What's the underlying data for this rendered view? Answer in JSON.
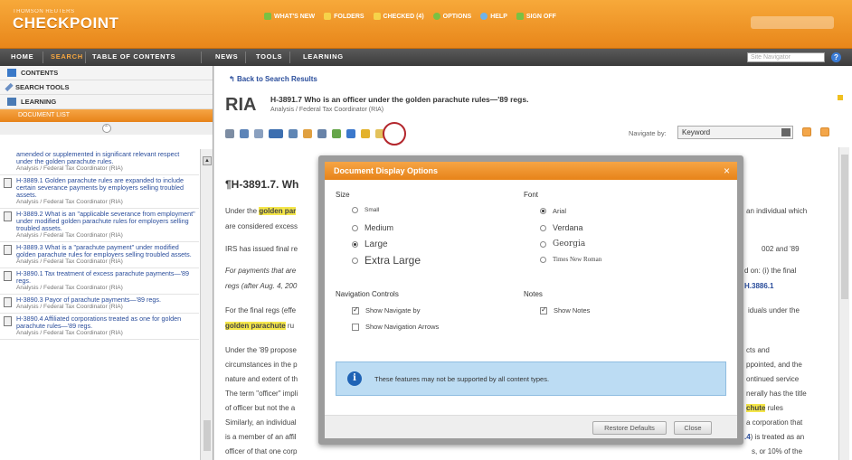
{
  "header": {
    "brand_small": "THOMSON REUTERS",
    "brand": "CHECKPOINT",
    "top_links": [
      "WHAT'S NEW",
      "FOLDERS",
      "CHECKED (4)",
      "OPTIONS",
      "HELP",
      "SIGN OFF"
    ],
    "top_link_colors": [
      "#7ac143",
      "#f6d34a",
      "#f6d34a",
      "#7ac143",
      "#6fb3e8",
      "#7ac143"
    ]
  },
  "nav": {
    "items": [
      "HOME",
      "SEARCH",
      "TABLE OF CONTENTS",
      "NEWS",
      "TOOLS",
      "LEARNING"
    ],
    "active": "SEARCH",
    "site_navigator_placeholder": "Site Navigator",
    "help": "?"
  },
  "sidebar": {
    "sections": [
      "CONTENTS",
      "SEARCH TOOLS",
      "LEARNING"
    ],
    "document_panel": "DOCUMENT LIST",
    "documents": [
      {
        "title": "amended or supplemented in significant relevant respect under the golden parachute rules.",
        "source": "Analysis / Federal Tax Coordinator (RIA)",
        "icon": false
      },
      {
        "title": "H-3889.1 Golden parachute rules are expanded to include certain severance payments by employers selling troubled assets.",
        "source": "Analysis / Federal Tax Coordinator (RIA)",
        "icon": true
      },
      {
        "title": "H-3889.2 What is an \"applicable severance from employment\" under modified golden parachute rules for employers selling troubled assets.",
        "source": "Analysis / Federal Tax Coordinator (RIA)",
        "icon": true
      },
      {
        "title": "H-3889.3 What is a \"parachute payment\" under modified golden parachute rules for employers selling troubled assets.",
        "source": "Analysis / Federal Tax Coordinator (RIA)",
        "icon": true
      },
      {
        "title": "H-3890.1 Tax treatment of excess parachute payments—'89 regs.",
        "source": "Analysis / Federal Tax Coordinator (RIA)",
        "icon": true
      },
      {
        "title": "H-3890.3 Payor of parachute payments—'89 regs.",
        "source": "Analysis / Federal Tax Coordinator (RIA)",
        "icon": true
      },
      {
        "title": "H-3890.4 Affiliated corporations treated as one for golden parachute rules—'89 regs.",
        "source": "Analysis / Federal Tax Coordinator (RIA)",
        "icon": true
      }
    ]
  },
  "main": {
    "back_link": "Back to Search Results",
    "ria": "RIA",
    "doc_title": "H-3891.7 Who is an officer under the golden parachute rules—'89 regs.",
    "doc_subtitle": "Analysis / Federal Tax Coordinator (RIA)",
    "navigate_by_label": "Navigate by:",
    "navigate_by_value": "Keyword",
    "para_heading": "¶H-3891.7. Wh",
    "body": {
      "l1_pre": "Under the ",
      "l1_hl": "golden par",
      "l2": "are considered excess",
      "l3": "IRS has issued final re",
      "l4": "For payments that are",
      "l5": "regs (after Aug. 4, 200",
      "l6": "For the final regs (effe",
      "l7_hl": "golden parachute",
      "l7_post": " ru",
      "l8": "Under the '89 propose",
      "l9": "circumstances in the p",
      "l10": "nature and extent of th",
      "l11": "The term \"officer\" impli",
      "l12": "of officer but not the a",
      "l13": "Similarly, an individual",
      "l14": "is a member of an affil",
      "l15": "officer of that one corp"
    },
    "body_right": {
      "r1": "an individual which",
      "r2": "002 and '89",
      "r3": "d on: (i) the final",
      "r4": "H.3886.1",
      "r5": "iduals under the",
      "r6": "cts and",
      "r7": "ppointed, and the",
      "r8": "ontinued service",
      "r9": "nerally has the title",
      "r10_hl": "chute",
      "r10_post": " rules",
      "r11": "a corporation that",
      "r12_link": ".4",
      "r12_post": ") is treated as an",
      "r13": "s, or 10% of the"
    }
  },
  "dialog": {
    "title": "Document Display Options",
    "close": "×",
    "size_label": "Size",
    "sizes": [
      "Small",
      "Medium",
      "Large",
      "Extra Large"
    ],
    "size_selected": "Large",
    "font_label": "Font",
    "fonts": [
      "Arial",
      "Verdana",
      "Georgia",
      "Times New Roman"
    ],
    "font_selected": "Arial",
    "navigation_label": "Navigation Controls",
    "show_navigate_by": "Show Navigate by",
    "show_navigate_by_checked": true,
    "show_navigation_arrows": "Show Navigation Arrows",
    "show_navigation_arrows_checked": false,
    "notes_label": "Notes",
    "show_notes": "Show Notes",
    "show_notes_checked": true,
    "info_text": "These features may not be supported by all content types.",
    "restore_defaults": "Restore Defaults",
    "close_button": "Close"
  }
}
